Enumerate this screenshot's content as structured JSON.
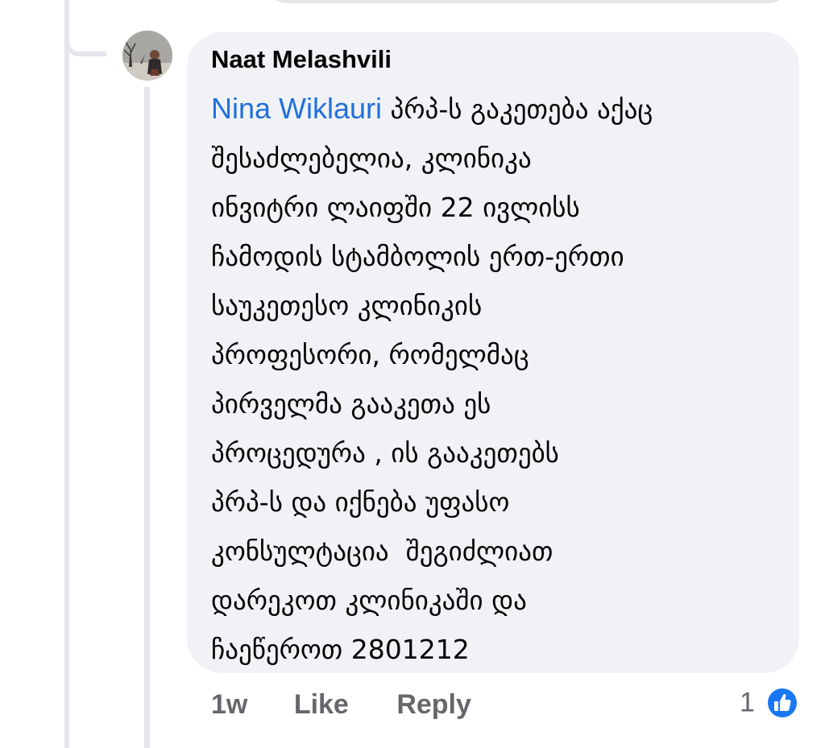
{
  "comment": {
    "author": "Naat Melashvili",
    "mention": "Nina Wiklauri",
    "text": " პრპ-ს გაკეთება აქაც\nშესაძლებელია, კლინიკა\nინვიტრი ლაიფში 22 ივლისს\nჩამოდის სტამბოლის ერთ-ერთი\nსაუკეთესო კლინიკის\nპროფესორი, რომელმაც\nპირველმა გააკეთა ეს\nპროცედურა , ის გააკეთებს\nპრპ-ს და იქნება უფასო\nკონსულტაცია  შეგიძლიათ\nდარეკოთ კლინიკაში და\nჩაეწეროთ 2801212",
    "time": "1w",
    "like_label": "Like",
    "reply_label": "Reply",
    "reaction_count": "1",
    "reaction_icon": "like-reaction-icon",
    "colors": {
      "bubble": "#f0f2f5",
      "mention": "#216fdb",
      "meta": "#65676b",
      "like_icon": "#1877f2"
    }
  }
}
